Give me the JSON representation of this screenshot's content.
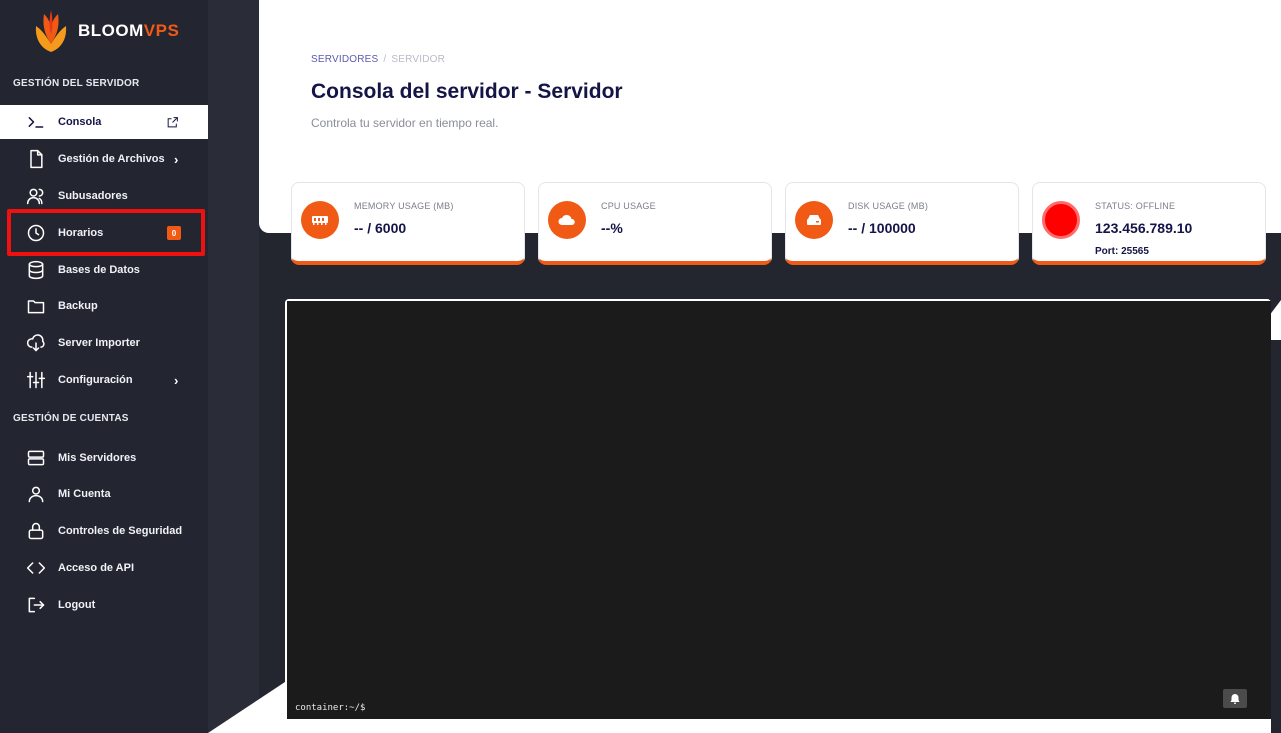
{
  "brand": {
    "name_main": "BLOOM",
    "name_accent": "VPS"
  },
  "sidebar": {
    "section_server": "GESTIÓN DEL SERVIDOR",
    "section_accounts": "GESTIÓN DE CUENTAS",
    "items": [
      {
        "label": "Consola",
        "icon": "terminal-icon"
      },
      {
        "label": "Gestión de Archivos",
        "icon": "file-icon"
      },
      {
        "label": "Subusadores",
        "icon": "users-icon"
      },
      {
        "label": "Horarios",
        "icon": "clock-icon",
        "badge": "0"
      },
      {
        "label": "Bases de Datos",
        "icon": "database-icon"
      },
      {
        "label": "Backup",
        "icon": "folder-icon"
      },
      {
        "label": "Server Importer",
        "icon": "cloud-download-icon"
      },
      {
        "label": "Configuración",
        "icon": "sliders-icon"
      },
      {
        "label": "Mis Servidores",
        "icon": "server-icon"
      },
      {
        "label": "Mi Cuenta",
        "icon": "user-icon"
      },
      {
        "label": "Controles de Seguridad",
        "icon": "lock-icon"
      },
      {
        "label": "Acceso de API",
        "icon": "code-icon"
      },
      {
        "label": "Logout",
        "icon": "logout-icon"
      }
    ]
  },
  "header": {
    "breadcrumb": [
      "SERVIDORES",
      "/",
      "SERVIDOR"
    ],
    "title": "Consola del servidor - Servidor",
    "subtitle": "Controla tu servidor en tiempo real."
  },
  "stats": [
    {
      "label": "MEMORY USAGE (MB)",
      "value": "-- / 6000",
      "icon": "memory-icon"
    },
    {
      "label": "CPU USAGE",
      "value": "--%",
      "icon": "cloud-icon"
    },
    {
      "label": "DISK USAGE (MB)",
      "value": "-- / 100000",
      "icon": "hdd-icon"
    },
    {
      "label": "STATUS: OFFLINE",
      "value": "123.456.789.10",
      "sub": "Port: 25565",
      "icon": "status-dot"
    }
  ],
  "console": {
    "prompt": "container:~/$"
  },
  "colors": {
    "accent": "#f05a14",
    "sidebar": "#232631",
    "title": "#141446",
    "offline": "#ff0000"
  }
}
